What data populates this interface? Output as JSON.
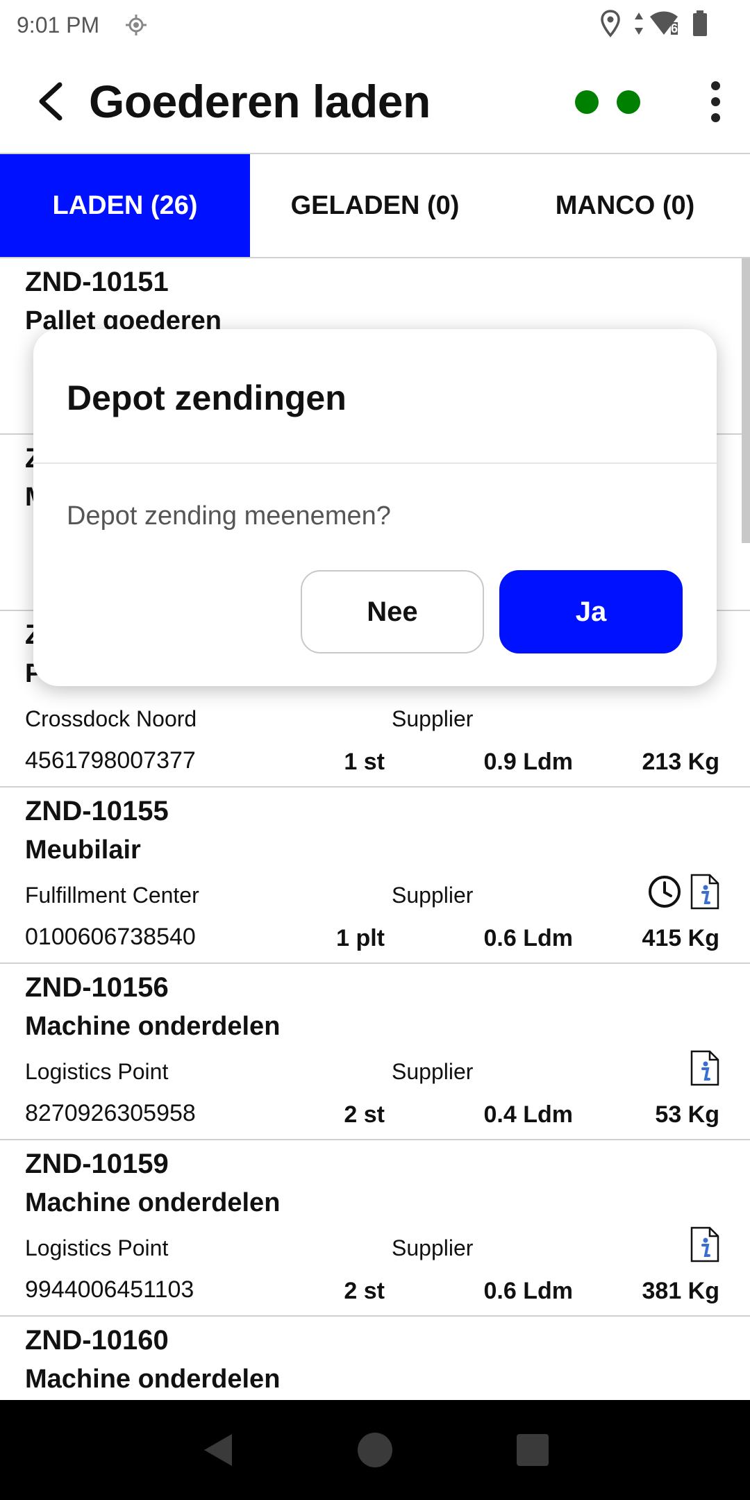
{
  "status_bar": {
    "time": "9:01 PM",
    "signal_badge": "6"
  },
  "app_bar": {
    "title": "Goederen laden",
    "status_dot_color": "#008000"
  },
  "tabs": [
    {
      "label": "LADEN (26)",
      "active": true
    },
    {
      "label": "GELADEN (0)",
      "active": false
    },
    {
      "label": "MANCO (0)",
      "active": false
    }
  ],
  "colors": {
    "accent": "#0011ff",
    "status_ok": "#008000"
  },
  "list": {
    "items": [
      {
        "id": "ZND-10151",
        "description": "Pallet goederen",
        "location": "",
        "supplier": "",
        "barcode": "",
        "qty": "",
        "ldm": "",
        "kg": ""
      },
      {
        "id": "ZND-",
        "description": "M",
        "location": "",
        "supplier": "",
        "barcode": "",
        "qty": "",
        "ldm": "",
        "kg": ""
      },
      {
        "id": "Z",
        "description": "P",
        "location": "Crossdock Noord",
        "supplier": "Supplier",
        "barcode": "4561798007377",
        "qty": "1 st",
        "ldm": "0.9 Ldm",
        "kg": "213 Kg"
      },
      {
        "id": "ZND-10155",
        "description": "Meubilair",
        "location": "Fulfillment Center",
        "supplier": "Supplier",
        "barcode": "0100606738540",
        "qty": "1 plt",
        "ldm": "0.6 Ldm",
        "kg": "415 Kg",
        "icons": [
          "clock-icon",
          "info-document-icon"
        ]
      },
      {
        "id": "ZND-10156",
        "description": "Machine onderdelen",
        "location": "Logistics Point",
        "supplier": "Supplier",
        "barcode": "8270926305958",
        "qty": "2 st",
        "ldm": "0.4 Ldm",
        "kg": "53 Kg",
        "icons": [
          "info-document-icon"
        ]
      },
      {
        "id": "ZND-10159",
        "description": "Machine onderdelen",
        "location": "Logistics Point",
        "supplier": "Supplier",
        "barcode": "9944006451103",
        "qty": "2 st",
        "ldm": "0.6 Ldm",
        "kg": "381 Kg",
        "icons": [
          "info-document-icon"
        ]
      },
      {
        "id": "ZND-10160",
        "description": "Machine onderdelen",
        "location": "",
        "supplier": "",
        "barcode": "",
        "qty": "",
        "ldm": "",
        "kg": ""
      }
    ]
  },
  "dialog": {
    "title": "Depot zendingen",
    "message": "Depot zending meenemen?",
    "no_label": "Nee",
    "yes_label": "Ja"
  }
}
